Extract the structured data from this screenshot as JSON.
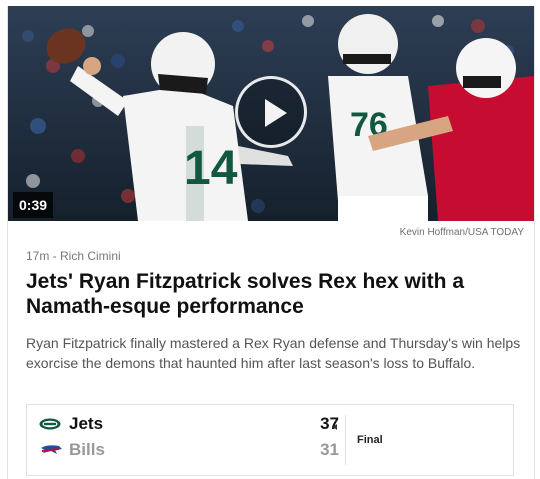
{
  "video": {
    "duration": "0:39",
    "photo_credit": "Kevin Hoffman/USA TODAY",
    "play_icon": "play-icon"
  },
  "article": {
    "meta": "17m - Rich Cimini",
    "headline": "Jets' Ryan Fitzpatrick solves Rex hex with a Namath-esque performance",
    "summary": "Ryan Fitzpatrick finally mastered a Rex Ryan defense and Thursday's win helps exorcise the demons that haunted him after last season's loss to Buffalo."
  },
  "scoreboard": {
    "teams": [
      {
        "name": "Jets",
        "score": "37",
        "logo": "jets-logo",
        "color": "#125740"
      },
      {
        "name": "Bills",
        "score": "31",
        "logo": "bills-logo",
        "color": "#c60c30"
      }
    ],
    "status": "Final"
  },
  "photo_jerseys": {
    "qb_number": "14",
    "lineman_number": "76"
  }
}
